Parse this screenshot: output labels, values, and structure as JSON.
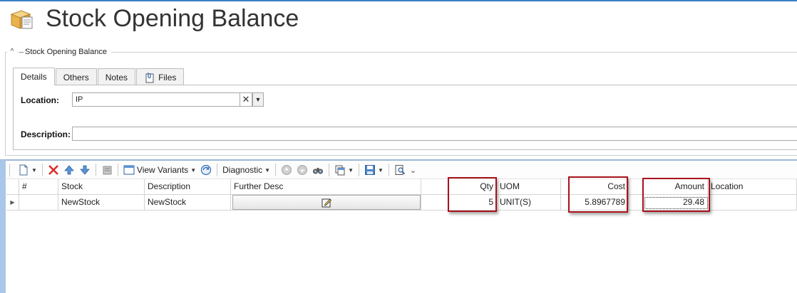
{
  "header": {
    "title": "Stock Opening Balance",
    "icon": "package-icon"
  },
  "group": {
    "legend": "Stock Opening Balance",
    "collapse_icon": "chevron-up-icon"
  },
  "tabs": [
    {
      "label": "Details",
      "active": true
    },
    {
      "label": "Others",
      "active": false
    },
    {
      "label": "Notes",
      "active": false
    },
    {
      "label": "Files",
      "active": false,
      "icon": "file-attach-icon"
    }
  ],
  "form": {
    "location_label": "Location:",
    "location_value": "IP",
    "description_label": "Description:",
    "description_value": ""
  },
  "toolbar": {
    "view_variants_label": "View Variants",
    "diagnostic_label": "Diagnostic"
  },
  "grid": {
    "columns": [
      "#",
      "Stock",
      "Description",
      "Further Desc",
      "Qty",
      "UOM",
      "Cost",
      "Amount",
      "Location"
    ],
    "rows": [
      {
        "num": "",
        "stock": "NewStock",
        "description": "NewStock",
        "further_desc": "",
        "qty": "5",
        "uom": "UNIT(S)",
        "cost": "5.8967789",
        "amount": "29.48",
        "location": ""
      }
    ]
  },
  "colors": {
    "accent": "#3b7fc4",
    "callout": "#a8121d",
    "delete": "#d9302c"
  }
}
